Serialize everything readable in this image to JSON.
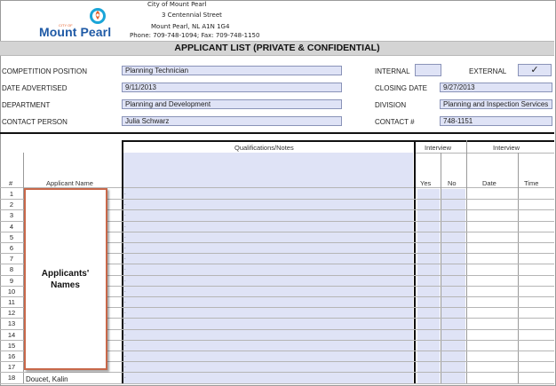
{
  "org": {
    "logo_small": "CITY OF",
    "logo_name": "Mount Pearl",
    "address_lines": [
      "City of Mount Pearl",
      "3 Centennial Street",
      "Mount Pearl, NL  A1N 1G4",
      "Phone: 709-748-1094; Fax: 709-748-1150"
    ]
  },
  "title": "APPLICANT LIST  (PRIVATE & CONFIDENTIAL)",
  "form": {
    "competition_position_label": "COMPETITION POSITION",
    "competition_position_value": "Planning Technician",
    "date_advertised_label": "DATE ADVERTISED",
    "date_advertised_value": "9/11/2013",
    "department_label": "DEPARTMENT",
    "department_value": "Planning and Development",
    "contact_person_label": "CONTACT PERSON",
    "contact_person_value": "Julia Schwarz",
    "internal_label": "INTERNAL",
    "internal_value": "",
    "external_label": "EXTERNAL",
    "external_value": "✓",
    "closing_date_label": "CLOSING DATE",
    "closing_date_value": "9/27/2013",
    "division_label": "DIVISION",
    "division_value": "Planning and Inspection Services",
    "contact_number_label": "CONTACT #",
    "contact_number_value": "748-1151"
  },
  "table": {
    "qualifications_header": "Qualifications/Notes",
    "interview_header_1": "Interview",
    "interview_header_2": "Interview",
    "num_header": "#",
    "name_header": "Applicant Name",
    "yes_header": "Yes",
    "no_header": "No",
    "date_header": "Date",
    "time_header": "Time",
    "row_numbers": [
      "1",
      "2",
      "3",
      "4",
      "5",
      "6",
      "7",
      "8",
      "9",
      "10",
      "11",
      "12",
      "13",
      "14",
      "15",
      "16",
      "17",
      "18"
    ],
    "last_row_name": "Doucet, Kalin",
    "dot": "."
  },
  "callout": {
    "text": "Applicants'\nNames",
    "border_color": "#c8684a"
  },
  "colors": {
    "field_fill": "#dfe3f6",
    "title_bar": "#d4d4d4",
    "logo_blue": "#1f5aa6",
    "logo_orange": "#e5602b"
  }
}
